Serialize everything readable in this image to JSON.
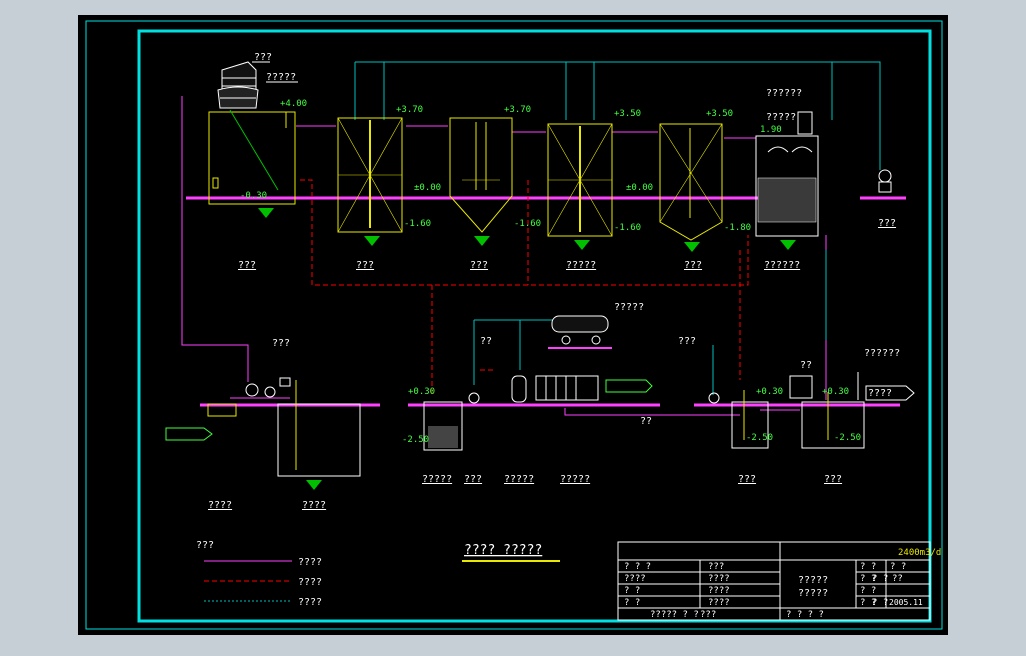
{
  "colors": {
    "frame_bg": "#c6ced6",
    "canvas": "#000000",
    "border": "#00e0e0",
    "equipment": "#e8e800",
    "text": "#ffffff",
    "level": "#40ff40",
    "sludge": "#ff0000",
    "water": "#ff40ff",
    "air": "#00c0c0",
    "ground": "#ff40ff"
  },
  "drawing_title": "???? ?????",
  "units": {
    "tank1": "???",
    "tank2": "???",
    "tank3": "???",
    "tank4": "?????",
    "tank5": "???",
    "tank6": "??????",
    "equip1": "???",
    "pump_pit": "????",
    "sump": "????",
    "sludge_tank": "?????",
    "unit_a": "???",
    "unit_b": "?????",
    "unit_c": "?????",
    "clear_well1": "???",
    "clear_well2": "???"
  },
  "labels": {
    "tower": "???",
    "tower_sub": "?????",
    "filter_top": "??????",
    "filter_sub": "?????",
    "compressor": "?????",
    "blower": "???",
    "pipe_gallery": "???",
    "dosing": "??",
    "well2_label": "??????",
    "outlet": "????",
    "bottom_mid": "??"
  },
  "elevations": {
    "e400": "+4.00",
    "e030a": "-0.30",
    "e370a": "+3.70",
    "e000a": "±0.00",
    "e160a": "-1.60",
    "e370b": "+3.70",
    "e350a": "+3.50",
    "e000b": "±0.00",
    "e160b": "-1.60",
    "e350b": "+3.50",
    "e180": "-1.80",
    "e190": "1.90",
    "e030b": "+0.30",
    "e250a": "-2.50",
    "e030c": "+0.30",
    "e250b": "-2.50",
    "e030d": "+0.30",
    "e250c": "-2.50"
  },
  "legend": {
    "title": "???",
    "items": [
      {
        "label": "????",
        "color": "#ff40ff",
        "style": "solid"
      },
      {
        "label": "????",
        "color": "#ff0000",
        "style": "dashed"
      },
      {
        "label": "????",
        "color": "#00c0c0",
        "style": "dotted"
      }
    ]
  },
  "title_block": {
    "r1c1": "? ? ?",
    "r1c2": "???",
    "r2c1": "????",
    "r2c2": "????",
    "r3c1": "? ?",
    "r3c2": "????",
    "r4c1": "? ?",
    "r4c2": "????",
    "capacity": "2400m3/d",
    "project_line1": "?????",
    "project_line2": "?????",
    "rr1c1": "? ?",
    "rr1c2": "? ?",
    "rr2c1": "? ?",
    "rr2c2": "? ?",
    "rr2c3": "??",
    "rr3c1": "? ?",
    "rr4c1": "? ?",
    "rr4c2": "? ?",
    "rr4c3": "2005.11",
    "footer_left": "????? ? ?",
    "footer_scale": "???",
    "footer_right": "? ? ? ?"
  }
}
